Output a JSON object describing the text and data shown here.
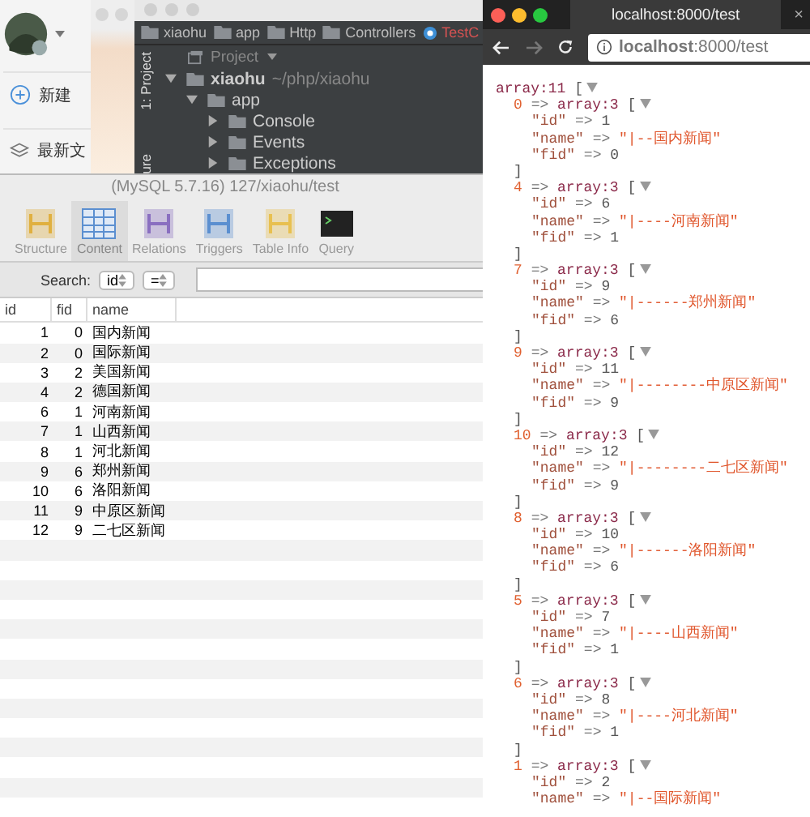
{
  "chat_app": {
    "items": [
      {
        "label": "新建"
      },
      {
        "label": "最新文"
      }
    ]
  },
  "ide": {
    "breadcrumbs": [
      {
        "label": "xiaohu",
        "kind": "folder"
      },
      {
        "label": "app",
        "kind": "folder"
      },
      {
        "label": "Http",
        "kind": "folder"
      },
      {
        "label": "Controllers",
        "kind": "folder"
      },
      {
        "label": "TestC",
        "kind": "file"
      }
    ],
    "side_tabs": [
      "1: Project",
      "ure"
    ],
    "panel_title": "Project",
    "tree": [
      {
        "label": "xiaohu",
        "path": "~/php/xiaohu",
        "expanded": true,
        "children": [
          {
            "label": "app",
            "expanded": true,
            "children": [
              {
                "label": "Console",
                "expanded": false
              },
              {
                "label": "Events",
                "expanded": false
              },
              {
                "label": "Exceptions",
                "expanded": false
              }
            ]
          }
        ]
      }
    ]
  },
  "db_window": {
    "title": "(MySQL 5.7.16) 127/xiaohu/test",
    "tools": [
      {
        "label": "Structure",
        "selected": false
      },
      {
        "label": "Content",
        "selected": true
      },
      {
        "label": "Relations",
        "selected": false
      },
      {
        "label": "Triggers",
        "selected": false
      },
      {
        "label": "Table Info",
        "selected": false
      },
      {
        "label": "Query",
        "selected": false
      }
    ],
    "search": {
      "label": "Search:",
      "field": "id",
      "operator": "="
    },
    "table": {
      "columns": [
        "id",
        "fid",
        "name"
      ],
      "rows": [
        [
          "1",
          "0",
          "国内新闻"
        ],
        [
          "2",
          "0",
          "国际新闻"
        ],
        [
          "3",
          "2",
          "美国新闻"
        ],
        [
          "4",
          "2",
          "德国新闻"
        ],
        [
          "6",
          "1",
          "河南新闻"
        ],
        [
          "7",
          "1",
          "山西新闻"
        ],
        [
          "8",
          "1",
          "河北新闻"
        ],
        [
          "9",
          "6",
          "郑州新闻"
        ],
        [
          "10",
          "6",
          "洛阳新闻"
        ],
        [
          "11",
          "9",
          "中原区新闻"
        ],
        [
          "12",
          "9",
          "二七区新闻"
        ]
      ]
    }
  },
  "browser": {
    "tab_title": "localhost:8000/test",
    "close": "×",
    "address": "**localhost**:8000/test",
    "dump": {
      "type": "array:11",
      "open": "[",
      "entries": [
        {
          "key": "0",
          "arrow": "=>",
          "type": "array:3",
          "open": "[",
          "close": "]",
          "fields": [
            {
              "key": "\"id\"",
              "arrow": "=>",
              "value": "1",
              "kind": "number"
            },
            {
              "key": "\"name\"",
              "arrow": "=>",
              "value": "\"|--国内新闻\"",
              "kind": "string"
            },
            {
              "key": "\"fid\"",
              "arrow": "=>",
              "value": "0",
              "kind": "number"
            }
          ]
        },
        {
          "key": "4",
          "arrow": "=>",
          "type": "array:3",
          "open": "[",
          "close": "]",
          "fields": [
            {
              "key": "\"id\"",
              "arrow": "=>",
              "value": "6",
              "kind": "number"
            },
            {
              "key": "\"name\"",
              "arrow": "=>",
              "value": "\"|----河南新闻\"",
              "kind": "string"
            },
            {
              "key": "\"fid\"",
              "arrow": "=>",
              "value": "1",
              "kind": "number"
            }
          ]
        },
        {
          "key": "7",
          "arrow": "=>",
          "type": "array:3",
          "open": "[",
          "close": "]",
          "fields": [
            {
              "key": "\"id\"",
              "arrow": "=>",
              "value": "9",
              "kind": "number"
            },
            {
              "key": "\"name\"",
              "arrow": "=>",
              "value": "\"|------郑州新闻\"",
              "kind": "string"
            },
            {
              "key": "\"fid\"",
              "arrow": "=>",
              "value": "6",
              "kind": "number"
            }
          ]
        },
        {
          "key": "9",
          "arrow": "=>",
          "type": "array:3",
          "open": "[",
          "close": "]",
          "fields": [
            {
              "key": "\"id\"",
              "arrow": "=>",
              "value": "11",
              "kind": "number"
            },
            {
              "key": "\"name\"",
              "arrow": "=>",
              "value": "\"|--------中原区新闻\"",
              "kind": "string"
            },
            {
              "key": "\"fid\"",
              "arrow": "=>",
              "value": "9",
              "kind": "number"
            }
          ]
        },
        {
          "key": "10",
          "arrow": "=>",
          "type": "array:3",
          "open": "[",
          "close": "]",
          "fields": [
            {
              "key": "\"id\"",
              "arrow": "=>",
              "value": "12",
              "kind": "number"
            },
            {
              "key": "\"name\"",
              "arrow": "=>",
              "value": "\"|--------二七区新闻\"",
              "kind": "string"
            },
            {
              "key": "\"fid\"",
              "arrow": "=>",
              "value": "9",
              "kind": "number"
            }
          ]
        },
        {
          "key": "8",
          "arrow": "=>",
          "type": "array:3",
          "open": "[",
          "close": "]",
          "fields": [
            {
              "key": "\"id\"",
              "arrow": "=>",
              "value": "10",
              "kind": "number"
            },
            {
              "key": "\"name\"",
              "arrow": "=>",
              "value": "\"|------洛阳新闻\"",
              "kind": "string"
            },
            {
              "key": "\"fid\"",
              "arrow": "=>",
              "value": "6",
              "kind": "number"
            }
          ]
        },
        {
          "key": "5",
          "arrow": "=>",
          "type": "array:3",
          "open": "[",
          "close": "]",
          "fields": [
            {
              "key": "\"id\"",
              "arrow": "=>",
              "value": "7",
              "kind": "number"
            },
            {
              "key": "\"name\"",
              "arrow": "=>",
              "value": "\"|----山西新闻\"",
              "kind": "string"
            },
            {
              "key": "\"fid\"",
              "arrow": "=>",
              "value": "1",
              "kind": "number"
            }
          ]
        },
        {
          "key": "6",
          "arrow": "=>",
          "type": "array:3",
          "open": "[",
          "close": "]",
          "fields": [
            {
              "key": "\"id\"",
              "arrow": "=>",
              "value": "8",
              "kind": "number"
            },
            {
              "key": "\"name\"",
              "arrow": "=>",
              "value": "\"|----河北新闻\"",
              "kind": "string"
            },
            {
              "key": "\"fid\"",
              "arrow": "=>",
              "value": "1",
              "kind": "number"
            }
          ]
        },
        {
          "key": "1",
          "arrow": "=>",
          "type": "array:3",
          "open": "[",
          "fields": [
            {
              "key": "\"id\"",
              "arrow": "=>",
              "value": "2",
              "kind": "number"
            },
            {
              "key": "\"name\"",
              "arrow": "=>",
              "value": "\"|--国际新闻\"",
              "kind": "string"
            }
          ]
        }
      ]
    }
  }
}
